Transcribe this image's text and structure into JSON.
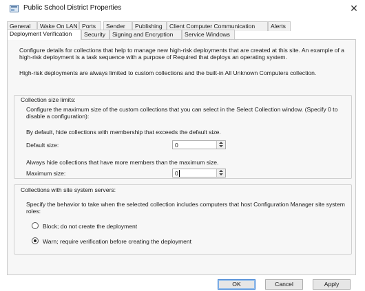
{
  "window": {
    "title": "Public School District Properties",
    "close_glyph": "✕"
  },
  "tabs": {
    "row1": [
      "General",
      "Wake On LAN",
      "Ports",
      "Sender",
      "Publishing",
      "Client Computer Communication",
      "Alerts"
    ],
    "row2": [
      "Deployment Verification",
      "Security",
      "Signing and Encryption",
      "Service Windows"
    ],
    "active": "Deployment Verification"
  },
  "intro": {
    "para1": "Configure details for collections that help to manage new high-risk deployments that are created at this site. An example of a high-risk deployment is a task sequence with a purpose of Required that deploys an operating system.",
    "para2": "High-risk deployments are always limited to custom collections and the built-in All Unknown Computers collection."
  },
  "collection_size": {
    "group_label": "Collection size limits:",
    "description": "Configure the maximum size of the custom collections that you can select in the Select Collection window. (Specify 0 to disable a configuration):",
    "default_hint": "By default, hide collections with membership that exceeds the default size.",
    "default_label": "Default size:",
    "default_value": "0",
    "max_hint": "Always hide collections that have more members than the maximum size.",
    "max_label": "Maximum size:",
    "max_value": "0"
  },
  "site_servers": {
    "group_label": "Collections with site system servers:",
    "description": "Specify the behavior to take when the selected collection includes computers that host Configuration Manager site system roles:",
    "options": [
      {
        "label": "Block; do not create the deployment",
        "checked": false
      },
      {
        "label": "Warn; require verification before creating the deployment",
        "checked": true
      }
    ]
  },
  "buttons": {
    "ok": "OK",
    "cancel": "Cancel",
    "apply": "Apply"
  }
}
